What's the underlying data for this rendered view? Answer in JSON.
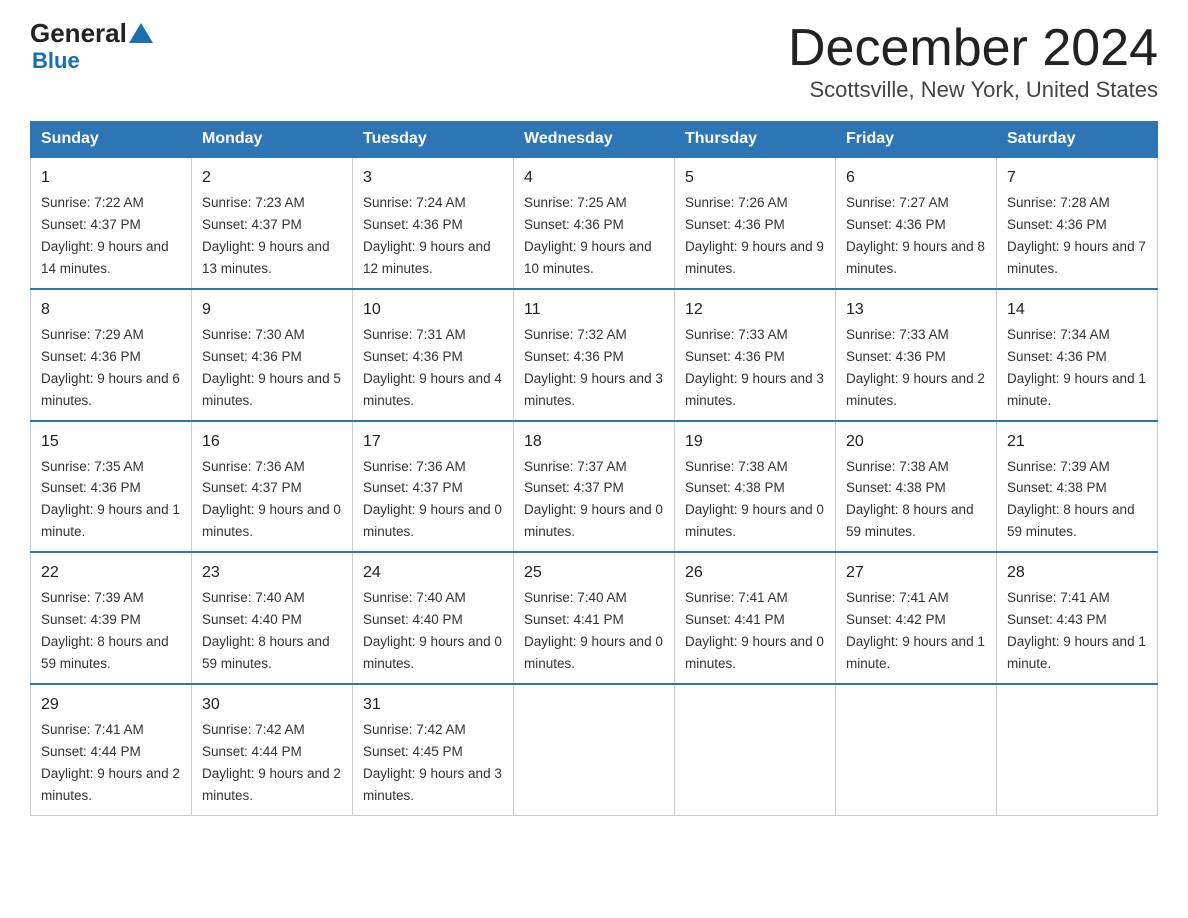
{
  "header": {
    "logo_general": "General",
    "logo_blue": "Blue",
    "main_title": "December 2024",
    "subtitle": "Scottsville, New York, United States"
  },
  "days_of_week": [
    "Sunday",
    "Monday",
    "Tuesday",
    "Wednesday",
    "Thursday",
    "Friday",
    "Saturday"
  ],
  "weeks": [
    [
      {
        "day": "1",
        "sunrise": "7:22 AM",
        "sunset": "4:37 PM",
        "daylight": "9 hours and 14 minutes."
      },
      {
        "day": "2",
        "sunrise": "7:23 AM",
        "sunset": "4:37 PM",
        "daylight": "9 hours and 13 minutes."
      },
      {
        "day": "3",
        "sunrise": "7:24 AM",
        "sunset": "4:36 PM",
        "daylight": "9 hours and 12 minutes."
      },
      {
        "day": "4",
        "sunrise": "7:25 AM",
        "sunset": "4:36 PM",
        "daylight": "9 hours and 10 minutes."
      },
      {
        "day": "5",
        "sunrise": "7:26 AM",
        "sunset": "4:36 PM",
        "daylight": "9 hours and 9 minutes."
      },
      {
        "day": "6",
        "sunrise": "7:27 AM",
        "sunset": "4:36 PM",
        "daylight": "9 hours and 8 minutes."
      },
      {
        "day": "7",
        "sunrise": "7:28 AM",
        "sunset": "4:36 PM",
        "daylight": "9 hours and 7 minutes."
      }
    ],
    [
      {
        "day": "8",
        "sunrise": "7:29 AM",
        "sunset": "4:36 PM",
        "daylight": "9 hours and 6 minutes."
      },
      {
        "day": "9",
        "sunrise": "7:30 AM",
        "sunset": "4:36 PM",
        "daylight": "9 hours and 5 minutes."
      },
      {
        "day": "10",
        "sunrise": "7:31 AM",
        "sunset": "4:36 PM",
        "daylight": "9 hours and 4 minutes."
      },
      {
        "day": "11",
        "sunrise": "7:32 AM",
        "sunset": "4:36 PM",
        "daylight": "9 hours and 3 minutes."
      },
      {
        "day": "12",
        "sunrise": "7:33 AM",
        "sunset": "4:36 PM",
        "daylight": "9 hours and 3 minutes."
      },
      {
        "day": "13",
        "sunrise": "7:33 AM",
        "sunset": "4:36 PM",
        "daylight": "9 hours and 2 minutes."
      },
      {
        "day": "14",
        "sunrise": "7:34 AM",
        "sunset": "4:36 PM",
        "daylight": "9 hours and 1 minute."
      }
    ],
    [
      {
        "day": "15",
        "sunrise": "7:35 AM",
        "sunset": "4:36 PM",
        "daylight": "9 hours and 1 minute."
      },
      {
        "day": "16",
        "sunrise": "7:36 AM",
        "sunset": "4:37 PM",
        "daylight": "9 hours and 0 minutes."
      },
      {
        "day": "17",
        "sunrise": "7:36 AM",
        "sunset": "4:37 PM",
        "daylight": "9 hours and 0 minutes."
      },
      {
        "day": "18",
        "sunrise": "7:37 AM",
        "sunset": "4:37 PM",
        "daylight": "9 hours and 0 minutes."
      },
      {
        "day": "19",
        "sunrise": "7:38 AM",
        "sunset": "4:38 PM",
        "daylight": "9 hours and 0 minutes."
      },
      {
        "day": "20",
        "sunrise": "7:38 AM",
        "sunset": "4:38 PM",
        "daylight": "8 hours and 59 minutes."
      },
      {
        "day": "21",
        "sunrise": "7:39 AM",
        "sunset": "4:38 PM",
        "daylight": "8 hours and 59 minutes."
      }
    ],
    [
      {
        "day": "22",
        "sunrise": "7:39 AM",
        "sunset": "4:39 PM",
        "daylight": "8 hours and 59 minutes."
      },
      {
        "day": "23",
        "sunrise": "7:40 AM",
        "sunset": "4:40 PM",
        "daylight": "8 hours and 59 minutes."
      },
      {
        "day": "24",
        "sunrise": "7:40 AM",
        "sunset": "4:40 PM",
        "daylight": "9 hours and 0 minutes."
      },
      {
        "day": "25",
        "sunrise": "7:40 AM",
        "sunset": "4:41 PM",
        "daylight": "9 hours and 0 minutes."
      },
      {
        "day": "26",
        "sunrise": "7:41 AM",
        "sunset": "4:41 PM",
        "daylight": "9 hours and 0 minutes."
      },
      {
        "day": "27",
        "sunrise": "7:41 AM",
        "sunset": "4:42 PM",
        "daylight": "9 hours and 1 minute."
      },
      {
        "day": "28",
        "sunrise": "7:41 AM",
        "sunset": "4:43 PM",
        "daylight": "9 hours and 1 minute."
      }
    ],
    [
      {
        "day": "29",
        "sunrise": "7:41 AM",
        "sunset": "4:44 PM",
        "daylight": "9 hours and 2 minutes."
      },
      {
        "day": "30",
        "sunrise": "7:42 AM",
        "sunset": "4:44 PM",
        "daylight": "9 hours and 2 minutes."
      },
      {
        "day": "31",
        "sunrise": "7:42 AM",
        "sunset": "4:45 PM",
        "daylight": "9 hours and 3 minutes."
      },
      null,
      null,
      null,
      null
    ]
  ],
  "labels": {
    "sunrise": "Sunrise:",
    "sunset": "Sunset:",
    "daylight": "Daylight:"
  }
}
